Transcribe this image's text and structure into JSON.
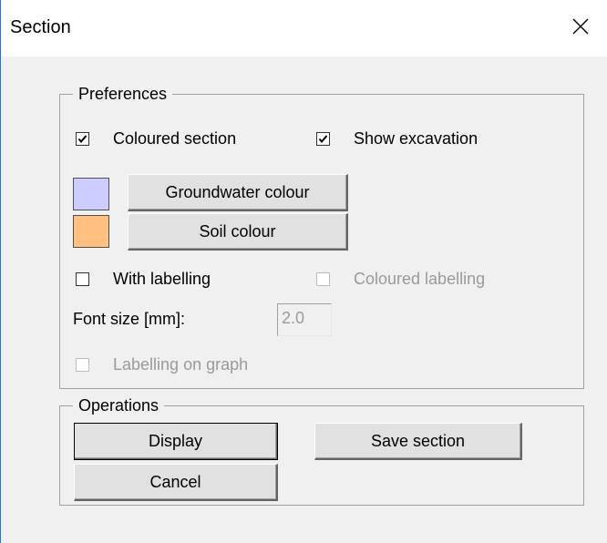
{
  "window": {
    "title": "Section",
    "close_glyph": "✕"
  },
  "preferences": {
    "legend": "Preferences",
    "coloured_section": {
      "label": "Coloured section",
      "checked": true
    },
    "show_excavation": {
      "label": "Show excavation",
      "checked": true
    },
    "groundwater_colour": {
      "label": "Groundwater colour",
      "swatch": "#ccccff"
    },
    "soil_colour": {
      "label": "Soil colour",
      "swatch": "#ffc080"
    },
    "with_labelling": {
      "label": "With labelling",
      "checked": false
    },
    "coloured_labelling": {
      "label": "Coloured labelling",
      "checked": false,
      "enabled": false
    },
    "font_size": {
      "label": "Font size [mm]:",
      "value": "2.0",
      "enabled": false
    },
    "labelling_on_graph": {
      "label": "Labelling on graph",
      "checked": false,
      "enabled": false
    }
  },
  "operations": {
    "legend": "Operations",
    "display_label": "Display",
    "save_section_label": "Save section",
    "cancel_label": "Cancel"
  },
  "colors": {
    "window_bg": "#f0f0f0",
    "title_bg": "#ffffff",
    "accent_border": "#1a78d4"
  }
}
